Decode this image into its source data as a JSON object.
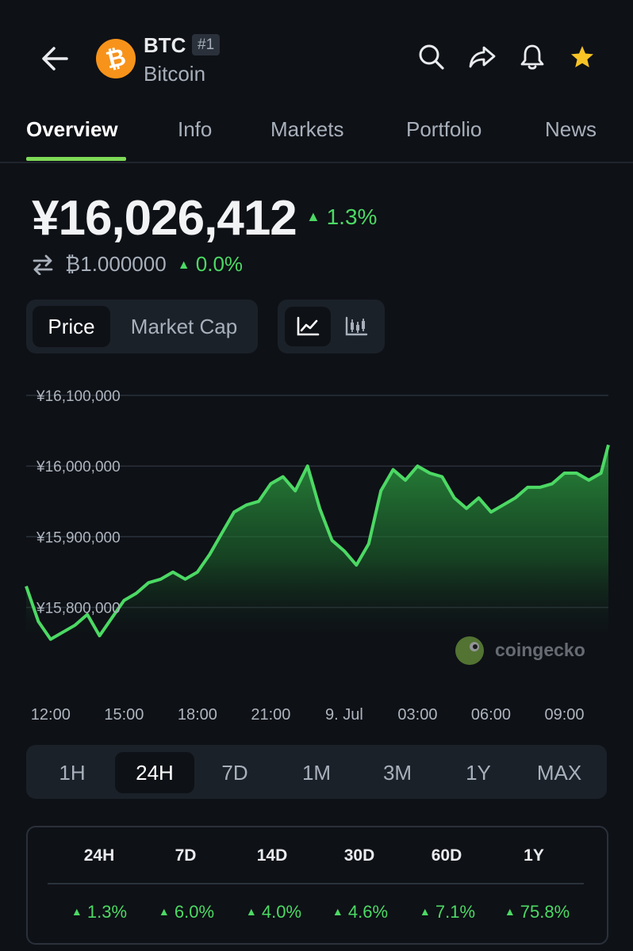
{
  "header": {
    "symbol": "BTC",
    "rank": "#1",
    "name": "Bitcoin",
    "logo_glyph": "₿",
    "icons": [
      "back-arrow-icon",
      "search-icon",
      "share-icon",
      "bell-icon",
      "star-icon"
    ]
  },
  "tabs": [
    {
      "label": "Overview",
      "active": true
    },
    {
      "label": "Info"
    },
    {
      "label": "Markets"
    },
    {
      "label": "Portfolio"
    },
    {
      "label": "News"
    }
  ],
  "price": {
    "value": "¥16,026,412",
    "change": "1.3%",
    "btc_value": "₿1.000000",
    "btc_change": "0.0%"
  },
  "toggles": {
    "metric": [
      "Price",
      "Market Cap"
    ],
    "metric_active": "Price",
    "chart_types": [
      "line-chart-icon",
      "candlestick-icon"
    ]
  },
  "chart_data": {
    "type": "area",
    "ylim": [
      15740000,
      16110000
    ],
    "y_ticks": [
      "¥16,100,000",
      "¥16,000,000",
      "¥15,900,000",
      "¥15,800,000"
    ],
    "y_tick_values": [
      16100000,
      16000000,
      15900000,
      15800000
    ],
    "x_ticks": [
      "12:00",
      "15:00",
      "18:00",
      "21:00",
      "9. Jul",
      "03:00",
      "06:00",
      "09:00"
    ],
    "x_start_hour": 11,
    "x_end_hour": 34.8,
    "x_tick_hours": [
      12,
      15,
      18,
      21,
      24,
      27,
      30,
      33
    ],
    "hours": [
      11,
      11.5,
      12,
      12.5,
      13,
      13.5,
      14,
      14.5,
      15,
      15.5,
      16,
      16.5,
      17,
      17.5,
      18,
      18.5,
      19,
      19.5,
      20,
      20.5,
      21,
      21.5,
      22,
      22.5,
      23,
      23.5,
      24,
      24.5,
      25,
      25.5,
      26,
      26.5,
      27,
      27.5,
      28,
      28.5,
      29,
      29.5,
      30,
      30.5,
      31,
      31.5,
      32,
      32.5,
      33,
      33.5,
      34,
      34.5,
      34.8
    ],
    "values": [
      15830000,
      15780000,
      15755000,
      15765000,
      15775000,
      15790000,
      15760000,
      15785000,
      15810000,
      15820000,
      15835000,
      15840000,
      15850000,
      15840000,
      15850000,
      15875000,
      15905000,
      15935000,
      15945000,
      15950000,
      15975000,
      15985000,
      15965000,
      16000000,
      15940000,
      15895000,
      15880000,
      15860000,
      15890000,
      15965000,
      15995000,
      15980000,
      16000000,
      15990000,
      15985000,
      15955000,
      15940000,
      15955000,
      15935000,
      15945000,
      15955000,
      15970000,
      15970000,
      15975000,
      15990000,
      15990000,
      15980000,
      15990000,
      16030000
    ],
    "line_color": "#4cd964",
    "watermark": "coingecko",
    "grid": true
  },
  "ranges": {
    "items": [
      "1H",
      "24H",
      "7D",
      "1M",
      "3M",
      "1Y",
      "MAX"
    ],
    "active": "24H"
  },
  "performance": {
    "headers": [
      "24H",
      "7D",
      "14D",
      "30D",
      "60D",
      "1Y"
    ],
    "values": [
      "1.3%",
      "6.0%",
      "4.0%",
      "4.6%",
      "7.1%",
      "75.8%"
    ]
  },
  "colors": {
    "up": "#4cd964",
    "accent": "#7ed957",
    "bg": "#0e1116"
  }
}
